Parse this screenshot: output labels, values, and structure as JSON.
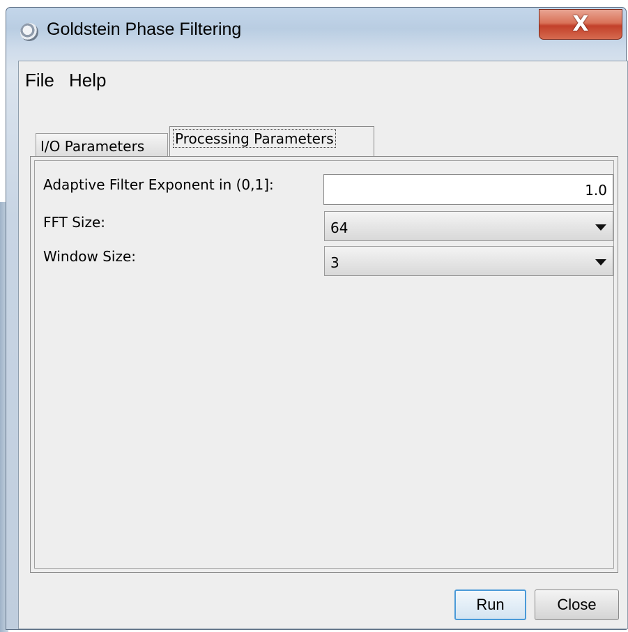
{
  "window": {
    "title": "Goldstein Phase Filtering",
    "app_icon": "esa-snap-logo-icon",
    "close_glyph": "X",
    "close_icon": "close-icon"
  },
  "menu": {
    "items": [
      {
        "label": "File"
      },
      {
        "label": "Help"
      }
    ]
  },
  "tabs": [
    {
      "label": "I/O Parameters",
      "selected": false
    },
    {
      "label": "Processing Parameters",
      "selected": true
    }
  ],
  "form": {
    "adaptive_filter": {
      "label": "Adaptive Filter Exponent in (0,1]:",
      "value": "1.0"
    },
    "fft_size": {
      "label": "FFT Size:",
      "value": "64",
      "arrow_icon": "dropdown-arrow-icon"
    },
    "window_size": {
      "label": "Window Size:",
      "value": "3",
      "arrow_icon": "dropdown-arrow-icon"
    }
  },
  "buttons": {
    "run": "Run",
    "close": "Close"
  },
  "colors": {
    "title_close_red": "#c2402a",
    "focus_blue": "#4a9ad8",
    "window_frame": "#b9cde2",
    "client_bg": "#eeeeee"
  }
}
